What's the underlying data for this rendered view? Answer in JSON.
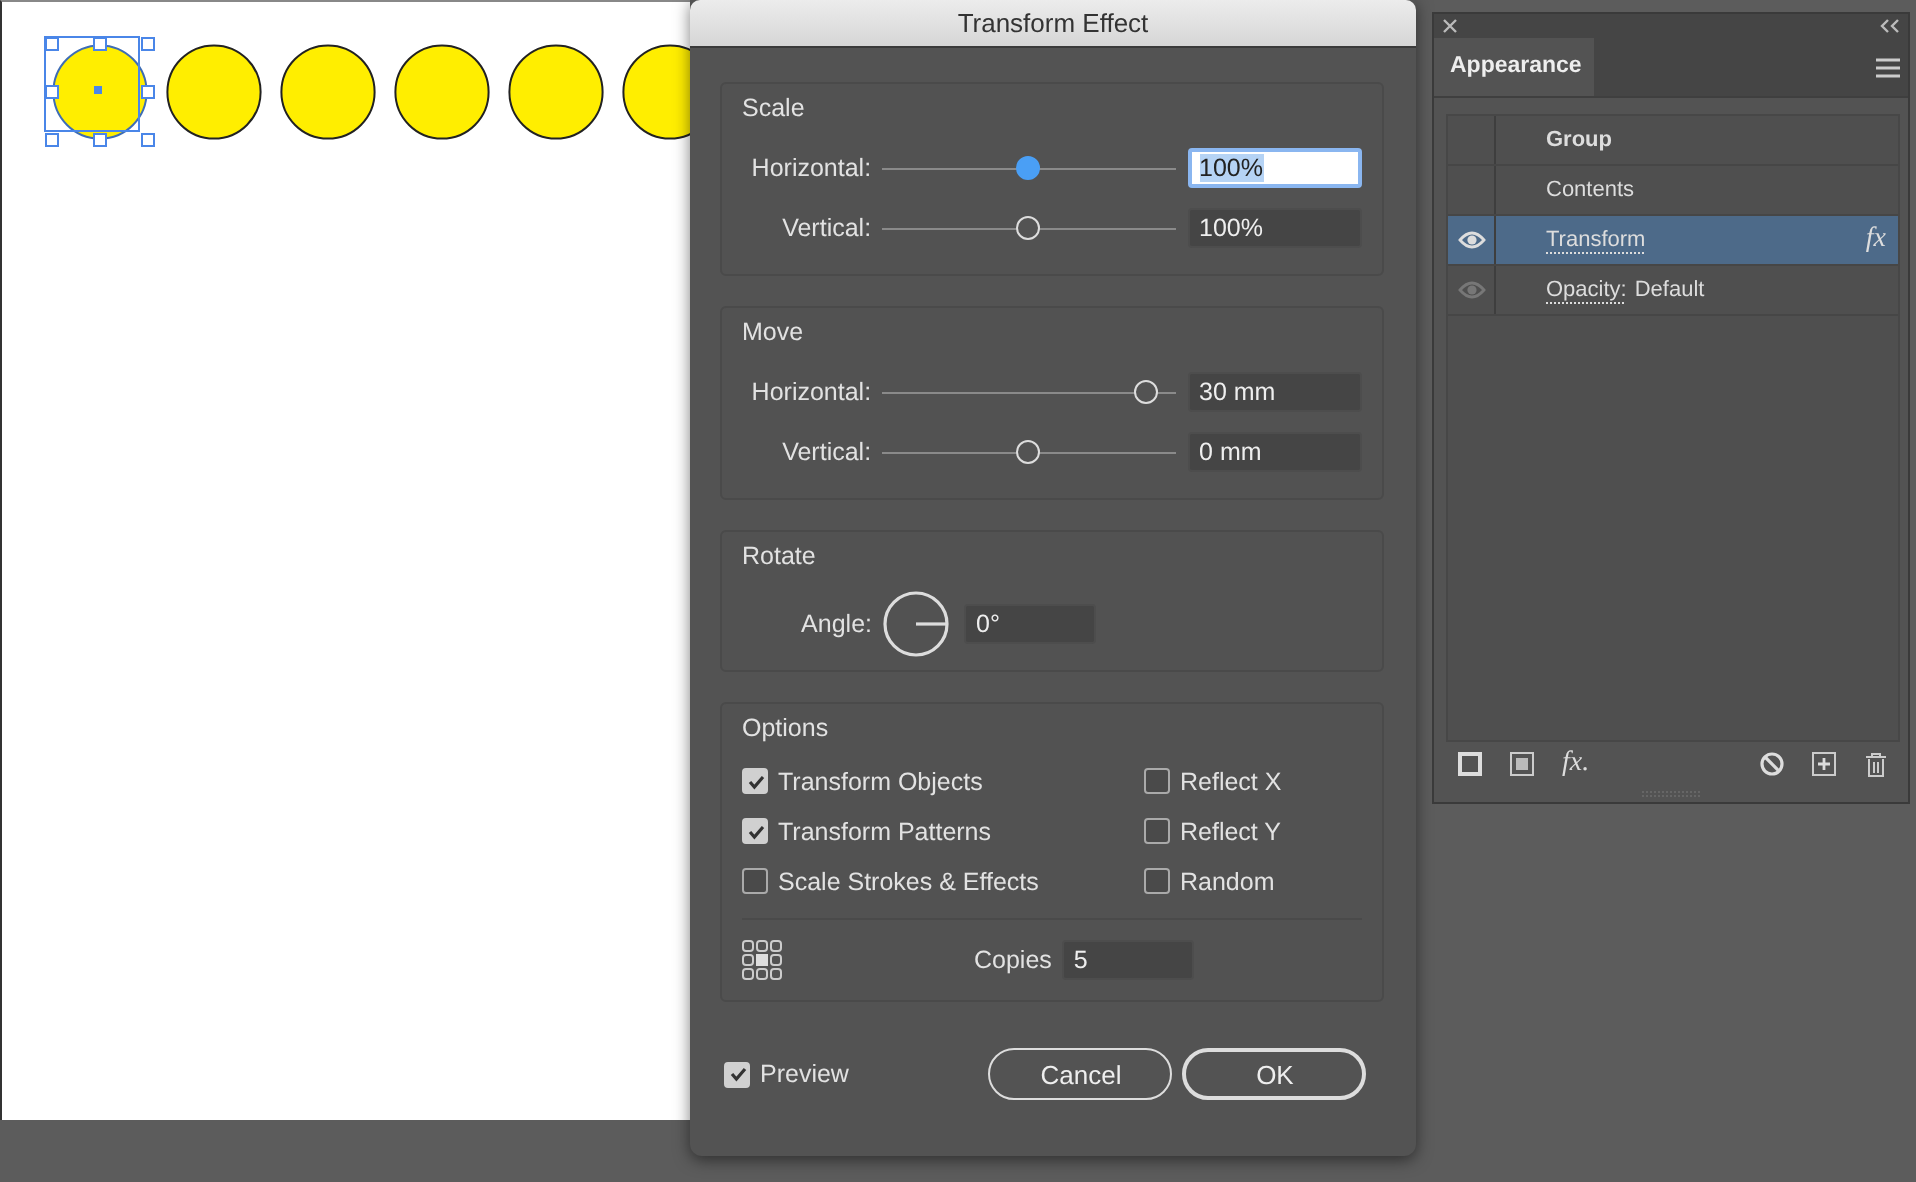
{
  "canvas": {
    "circles": [
      {
        "selected": true
      },
      {
        "selected": false
      },
      {
        "selected": false
      },
      {
        "selected": false
      },
      {
        "selected": false
      },
      {
        "selected": false
      }
    ]
  },
  "dialog": {
    "title": "Transform Effect",
    "sections": [
      {
        "title": "Scale",
        "sliders": [
          {
            "label": "Horizontal:",
            "level": 0.5,
            "value": "100%",
            "focused": true
          },
          {
            "label": "Vertical:",
            "level": 0.5,
            "value": "100%",
            "focused": false
          }
        ]
      },
      {
        "title": "Move",
        "sliders": [
          {
            "label": "Horizontal:",
            "level": 0.9,
            "value": "30 mm",
            "focused": false
          },
          {
            "label": "Vertical:",
            "level": 0.5,
            "value": "0 mm",
            "focused": false
          }
        ]
      }
    ],
    "rotate": {
      "title": "Rotate",
      "label": "Angle:",
      "value": "0°"
    },
    "options": {
      "title": "Options",
      "checkboxes": [
        {
          "label": "Transform Objects",
          "checked": true
        },
        {
          "label": "Reflect X",
          "checked": false
        },
        {
          "label": "Transform Patterns",
          "checked": true
        },
        {
          "label": "Reflect Y",
          "checked": false
        },
        {
          "label": "Scale Strokes & Effects",
          "checked": false
        },
        {
          "label": "Random",
          "checked": false
        }
      ],
      "copies_label": "Copies",
      "copies": "5"
    },
    "preview": {
      "label": "Preview",
      "checked": true
    },
    "buttons": [
      {
        "label": "Cancel",
        "default": false
      },
      {
        "label": "OK",
        "default": true
      }
    ]
  },
  "appearance": {
    "tab": "Appearance",
    "rows": [
      {
        "kind": "group",
        "label": "Group",
        "selected": false,
        "visible": false
      },
      {
        "kind": "contents",
        "label": "Contents",
        "selected": false,
        "visible": false
      },
      {
        "kind": "effect",
        "label": "Transform",
        "badge": "fx",
        "selected": true,
        "visible": true
      },
      {
        "kind": "attribute",
        "label": "Opacity:",
        "value": "Default",
        "selected": false,
        "visible": true
      }
    ],
    "toolbar": [
      {
        "kind": "stroke"
      },
      {
        "kind": "fill"
      },
      {
        "kind": "text",
        "label": "fx."
      },
      {
        "kind": "clear"
      },
      {
        "kind": "add"
      },
      {
        "kind": "trash"
      }
    ]
  }
}
